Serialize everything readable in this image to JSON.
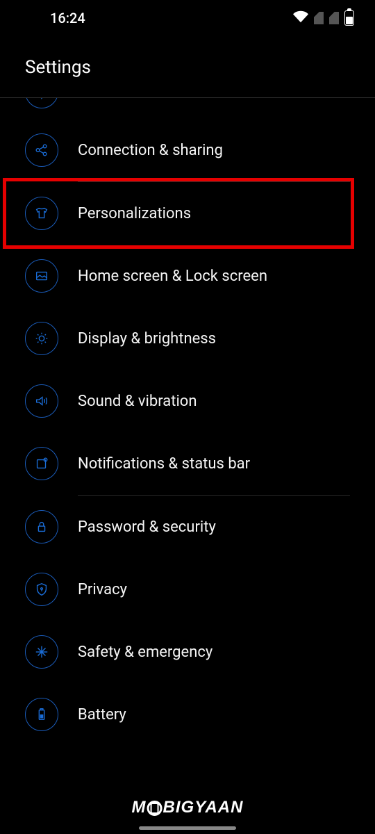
{
  "status": {
    "time": "16:24"
  },
  "header": {
    "title": "Settings"
  },
  "items": [
    {
      "label": "Connection & sharing"
    },
    {
      "label": "Personalizations"
    },
    {
      "label": "Home screen & Lock screen"
    },
    {
      "label": "Display & brightness"
    },
    {
      "label": "Sound & vibration"
    },
    {
      "label": "Notifications & status bar"
    },
    {
      "label": "Password & security"
    },
    {
      "label": "Privacy"
    },
    {
      "label": "Safety & emergency"
    },
    {
      "label": "Battery"
    }
  ],
  "watermark": {
    "part1": "M",
    "part2": "BIGYAAN"
  }
}
